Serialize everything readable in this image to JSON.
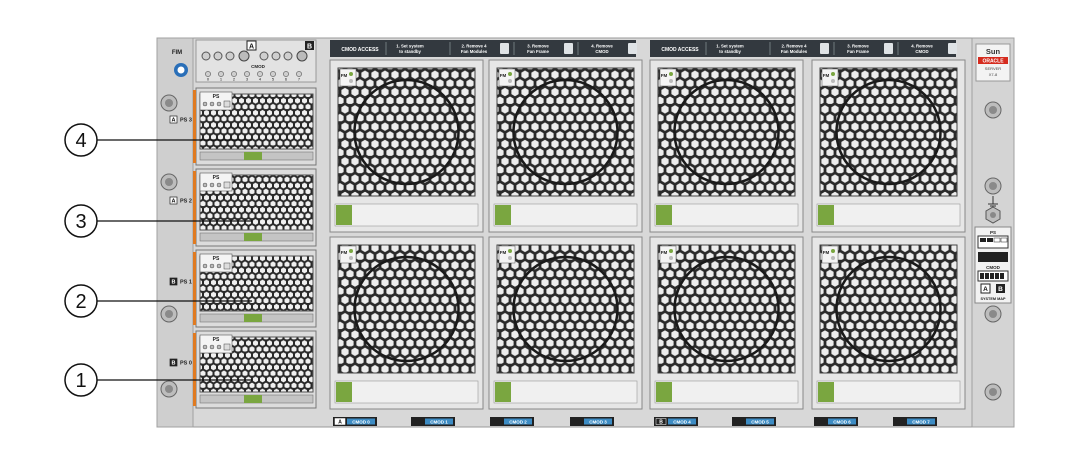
{
  "callouts": [
    "1",
    "2",
    "3",
    "4"
  ],
  "left_panel": {
    "fim_label": "FIM",
    "cmod_label": "CMOD",
    "slot_a": "A",
    "slot_b": "B",
    "cmod_numbers": [
      "0",
      "1",
      "2",
      "3",
      "4",
      "5",
      "6",
      "7"
    ]
  },
  "psus": [
    {
      "label": "PS 3",
      "slot": "A"
    },
    {
      "label": "PS 2",
      "slot": "A"
    },
    {
      "label": "PS 1",
      "slot": "B"
    },
    {
      "label": "PS 0",
      "slot": "B"
    }
  ],
  "psu_tag": "PS",
  "fan_tag": "FM",
  "banners": [
    {
      "access": "CMOD ACCESS",
      "steps": [
        {
          "a": "1. Set system",
          "b": "to standby"
        },
        {
          "a": "2. Remove 4",
          "b": "Fan Modules"
        },
        {
          "a": "3. Remove",
          "b": "Fan Frame"
        },
        {
          "a": "4. Remove",
          "b": "CMOD"
        }
      ]
    },
    {
      "access": "CMOD ACCESS",
      "steps": [
        {
          "a": "1. Set system",
          "b": "to standby"
        },
        {
          "a": "2. Remove 4",
          "b": "Fan Modules"
        },
        {
          "a": "3. Remove",
          "b": "Fan Frame"
        },
        {
          "a": "4. Remove",
          "b": "CMOD"
        }
      ]
    }
  ],
  "cmods": [
    {
      "label": "CMOD 0",
      "tag": "A"
    },
    {
      "label": "CMOD 1",
      "tag": ""
    },
    {
      "label": "CMOD 2",
      "tag": ""
    },
    {
      "label": "CMOD 3",
      "tag": ""
    },
    {
      "label": "CMOD 4",
      "tag": "B"
    },
    {
      "label": "CMOD 5",
      "tag": ""
    },
    {
      "label": "CMOD 6",
      "tag": ""
    },
    {
      "label": "CMOD 7",
      "tag": ""
    }
  ],
  "brand": {
    "sun": "Sun",
    "oracle": "ORACLE",
    "server": "SERVER",
    "model": "X7-8"
  },
  "right_panel": {
    "ps_title": "PS",
    "cmod_title": "CMOD",
    "a": "A",
    "b": "B",
    "system_map": "SYSTEM MAP"
  },
  "colors": {
    "chassis": "#d6d6d6",
    "fan_frame": "#e4e4e4",
    "grille": "#2f2f2f",
    "latch_green": "#7aa640",
    "banner": "#33393f",
    "label_blue": "#3d8cc4",
    "psu_orange": "#e07a20"
  }
}
